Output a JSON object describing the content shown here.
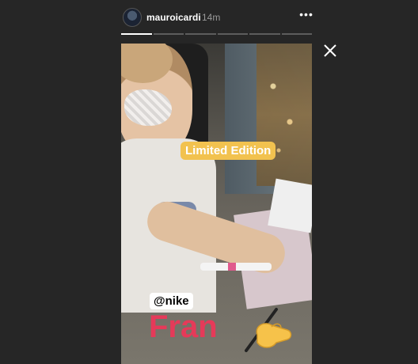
{
  "header": {
    "username": "mauroicardi",
    "time": "14m",
    "more_label": "•••"
  },
  "progress": {
    "segments": 6,
    "active_index": 0
  },
  "story": {
    "stickers": {
      "limited": "Limited Edition",
      "mention": "@nike",
      "name": "Fran"
    },
    "emoji": "writing-hand"
  },
  "colors": {
    "background": "#262626",
    "sticker_yellow": "#f2c24f",
    "name_red": "#e53a59"
  }
}
